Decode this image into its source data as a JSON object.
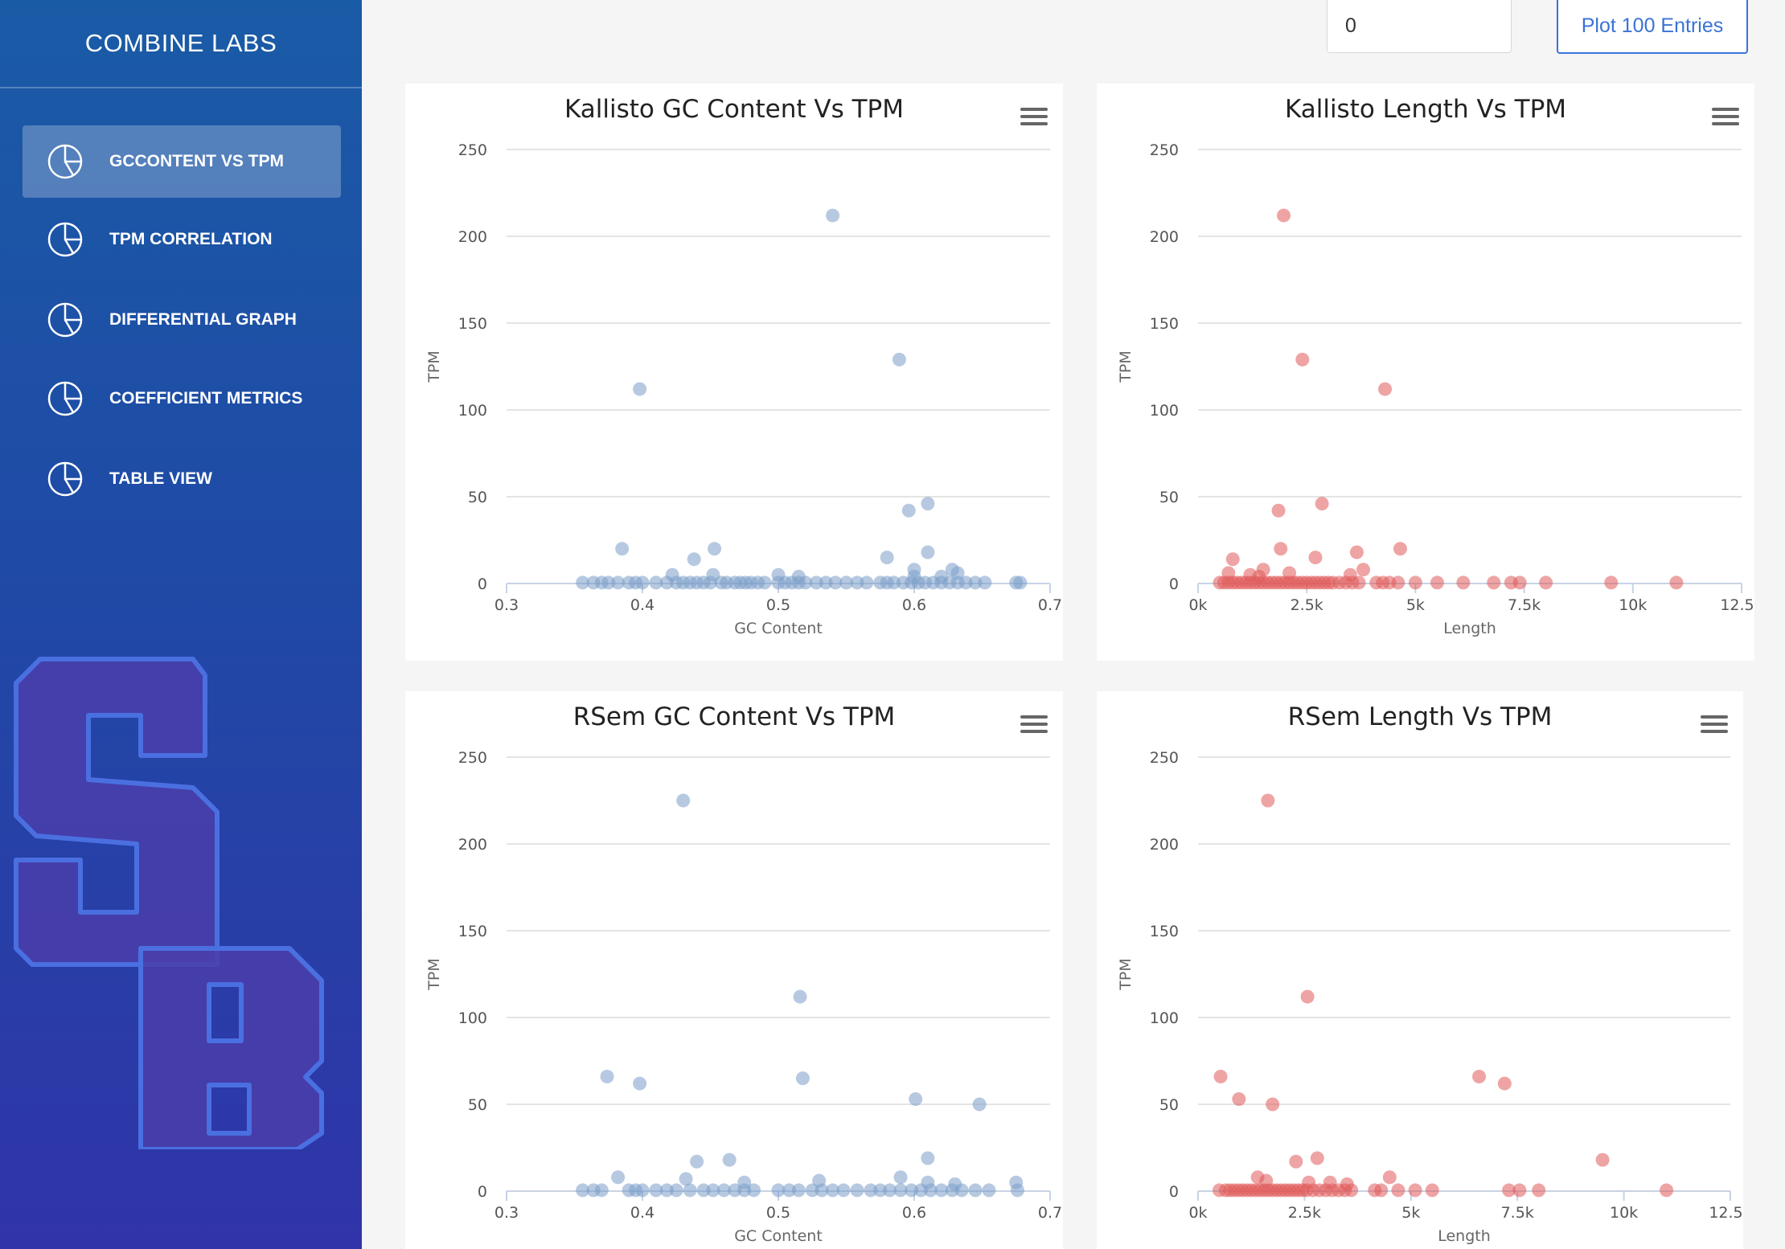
{
  "sidebar": {
    "brand": "COMBINE LABS",
    "items": [
      {
        "label": "GCCONTENT VS TPM",
        "icon": "pie-chart-icon",
        "active": true
      },
      {
        "label": "TPM CORRELATION",
        "icon": "pie-chart-icon",
        "active": false
      },
      {
        "label": "DIFFERENTIAL GRAPH",
        "icon": "pie-chart-icon",
        "active": false
      },
      {
        "label": "COEFFICIENT METRICS",
        "icon": "pie-chart-icon",
        "active": false
      },
      {
        "label": "TABLE VIEW",
        "icon": "pie-chart-icon",
        "active": false
      }
    ],
    "logo_icon": "sb-logo-icon"
  },
  "toolbar": {
    "offset_value": "0",
    "plot_button_label": "Plot 100 Entries"
  },
  "colors": {
    "accent": "#3a73d6",
    "blue_series": "#7a9cc8",
    "red_series": "#e05a5a"
  },
  "chart_data": [
    {
      "type": "scatter",
      "title": "Kallisto GC Content Vs TPM",
      "xlabel": "GC Content",
      "ylabel": "TPM",
      "xlim": [
        0.3,
        0.7
      ],
      "ylim": [
        0,
        250
      ],
      "xticks": [
        "0.3",
        "0.4",
        "0.5",
        "0.6",
        "0.7"
      ],
      "yticks": [
        "0",
        "50",
        "100",
        "150",
        "200",
        "250"
      ],
      "grid": true,
      "color": "#7a9cc8",
      "points": [
        [
          0.54,
          212
        ],
        [
          0.589,
          129
        ],
        [
          0.398,
          112
        ],
        [
          0.61,
          46
        ],
        [
          0.596,
          42
        ],
        [
          0.385,
          20
        ],
        [
          0.453,
          20
        ],
        [
          0.61,
          18
        ],
        [
          0.438,
          14
        ],
        [
          0.58,
          15
        ],
        [
          0.6,
          8
        ],
        [
          0.628,
          8
        ],
        [
          0.632,
          6
        ],
        [
          0.422,
          5
        ],
        [
          0.452,
          5
        ],
        [
          0.5,
          5
        ],
        [
          0.515,
          4
        ],
        [
          0.6,
          4
        ],
        [
          0.62,
          4
        ],
        [
          0.356,
          0.5
        ],
        [
          0.364,
          0.5
        ],
        [
          0.37,
          0.5
        ],
        [
          0.375,
          0.5
        ],
        [
          0.382,
          0.5
        ],
        [
          0.39,
          0.5
        ],
        [
          0.395,
          0.5
        ],
        [
          0.4,
          0.5
        ],
        [
          0.41,
          0.5
        ],
        [
          0.418,
          0.5
        ],
        [
          0.425,
          0.5
        ],
        [
          0.43,
          0.5
        ],
        [
          0.435,
          0.5
        ],
        [
          0.44,
          0.5
        ],
        [
          0.445,
          0.5
        ],
        [
          0.45,
          0.5
        ],
        [
          0.458,
          0.5
        ],
        [
          0.462,
          0.5
        ],
        [
          0.468,
          0.5
        ],
        [
          0.472,
          0.5
        ],
        [
          0.476,
          0.5
        ],
        [
          0.48,
          0.5
        ],
        [
          0.485,
          0.5
        ],
        [
          0.49,
          0.5
        ],
        [
          0.5,
          0.5
        ],
        [
          0.505,
          0.5
        ],
        [
          0.51,
          0.5
        ],
        [
          0.515,
          0.5
        ],
        [
          0.52,
          0.5
        ],
        [
          0.528,
          0.5
        ],
        [
          0.535,
          0.5
        ],
        [
          0.542,
          0.5
        ],
        [
          0.55,
          0.5
        ],
        [
          0.558,
          0.5
        ],
        [
          0.565,
          0.5
        ],
        [
          0.575,
          0.5
        ],
        [
          0.58,
          0.5
        ],
        [
          0.585,
          0.5
        ],
        [
          0.592,
          0.5
        ],
        [
          0.598,
          0.5
        ],
        [
          0.603,
          0.5
        ],
        [
          0.608,
          0.5
        ],
        [
          0.614,
          0.5
        ],
        [
          0.62,
          0.5
        ],
        [
          0.626,
          0.5
        ],
        [
          0.632,
          0.5
        ],
        [
          0.638,
          0.5
        ],
        [
          0.645,
          0.5
        ],
        [
          0.652,
          0.5
        ],
        [
          0.675,
          0.5
        ],
        [
          0.678,
          0.5
        ]
      ]
    },
    {
      "type": "scatter",
      "title": "Kallisto Length Vs TPM",
      "xlabel": "Length",
      "ylabel": "TPM",
      "xlim": [
        0,
        12500
      ],
      "ylim": [
        0,
        250
      ],
      "xticks": [
        "0k",
        "2.5k",
        "5k",
        "7.5k",
        "10k",
        "12.5k"
      ],
      "yticks": [
        "0",
        "50",
        "100",
        "150",
        "200",
        "250"
      ],
      "grid": true,
      "color": "#e05a5a",
      "points": [
        [
          1970,
          212
        ],
        [
          2400,
          129
        ],
        [
          4300,
          112
        ],
        [
          2850,
          46
        ],
        [
          1850,
          42
        ],
        [
          4650,
          20
        ],
        [
          1900,
          20
        ],
        [
          3650,
          18
        ],
        [
          800,
          14
        ],
        [
          2700,
          15
        ],
        [
          3800,
          8
        ],
        [
          1500,
          8
        ],
        [
          2100,
          6
        ],
        [
          700,
          6
        ],
        [
          3500,
          5
        ],
        [
          1200,
          5
        ],
        [
          1400,
          4
        ],
        [
          500,
          0.5
        ],
        [
          600,
          0.5
        ],
        [
          700,
          0.5
        ],
        [
          800,
          0.5
        ],
        [
          900,
          0.5
        ],
        [
          1000,
          0.5
        ],
        [
          1100,
          0.5
        ],
        [
          1200,
          0.5
        ],
        [
          1300,
          0.5
        ],
        [
          1400,
          0.5
        ],
        [
          1500,
          0.5
        ],
        [
          1600,
          0.5
        ],
        [
          1700,
          0.5
        ],
        [
          1800,
          0.5
        ],
        [
          1900,
          0.5
        ],
        [
          2000,
          0.5
        ],
        [
          2100,
          0.5
        ],
        [
          2200,
          0.5
        ],
        [
          2300,
          0.5
        ],
        [
          2400,
          0.5
        ],
        [
          2500,
          0.5
        ],
        [
          2600,
          0.5
        ],
        [
          2700,
          0.5
        ],
        [
          2800,
          0.5
        ],
        [
          2900,
          0.5
        ],
        [
          3000,
          0.5
        ],
        [
          3100,
          0.5
        ],
        [
          3250,
          0.5
        ],
        [
          3400,
          0.5
        ],
        [
          3550,
          0.5
        ],
        [
          3700,
          0.5
        ],
        [
          4100,
          0.5
        ],
        [
          4250,
          0.5
        ],
        [
          4400,
          0.5
        ],
        [
          4600,
          0.5
        ],
        [
          5000,
          0.5
        ],
        [
          5500,
          0.5
        ],
        [
          6100,
          0.5
        ],
        [
          6800,
          0.5
        ],
        [
          7200,
          0.5
        ],
        [
          7400,
          0.5
        ],
        [
          8000,
          0.5
        ],
        [
          9500,
          0.5
        ],
        [
          11000,
          0.5
        ]
      ]
    },
    {
      "type": "scatter",
      "title": "RSem GC Content Vs TPM",
      "xlabel": "GC Content",
      "ylabel": "TPM",
      "xlim": [
        0.3,
        0.7
      ],
      "ylim": [
        0,
        250
      ],
      "xticks": [
        "0.3",
        "0.4",
        "0.5",
        "0.6",
        "0.7"
      ],
      "yticks": [
        "0",
        "50",
        "100",
        "150",
        "200",
        "250"
      ],
      "grid": true,
      "color": "#7a9cc8",
      "points": [
        [
          0.43,
          225
        ],
        [
          0.516,
          112
        ],
        [
          0.374,
          66
        ],
        [
          0.398,
          62
        ],
        [
          0.518,
          65
        ],
        [
          0.601,
          53
        ],
        [
          0.648,
          50
        ],
        [
          0.61,
          19
        ],
        [
          0.464,
          18
        ],
        [
          0.44,
          17
        ],
        [
          0.382,
          8
        ],
        [
          0.432,
          7
        ],
        [
          0.59,
          8
        ],
        [
          0.53,
          6
        ],
        [
          0.61,
          5
        ],
        [
          0.475,
          5
        ],
        [
          0.63,
          4
        ],
        [
          0.675,
          5
        ],
        [
          0.356,
          0.5
        ],
        [
          0.364,
          0.5
        ],
        [
          0.37,
          0.5
        ],
        [
          0.39,
          0.5
        ],
        [
          0.395,
          0.5
        ],
        [
          0.4,
          0.5
        ],
        [
          0.41,
          0.5
        ],
        [
          0.418,
          0.5
        ],
        [
          0.425,
          0.5
        ],
        [
          0.435,
          0.5
        ],
        [
          0.445,
          0.5
        ],
        [
          0.452,
          0.5
        ],
        [
          0.46,
          0.5
        ],
        [
          0.468,
          0.5
        ],
        [
          0.475,
          0.5
        ],
        [
          0.482,
          0.5
        ],
        [
          0.5,
          0.5
        ],
        [
          0.508,
          0.5
        ],
        [
          0.515,
          0.5
        ],
        [
          0.525,
          0.5
        ],
        [
          0.532,
          0.5
        ],
        [
          0.54,
          0.5
        ],
        [
          0.548,
          0.5
        ],
        [
          0.558,
          0.5
        ],
        [
          0.568,
          0.5
        ],
        [
          0.575,
          0.5
        ],
        [
          0.582,
          0.5
        ],
        [
          0.59,
          0.5
        ],
        [
          0.598,
          0.5
        ],
        [
          0.605,
          0.5
        ],
        [
          0.612,
          0.5
        ],
        [
          0.62,
          0.5
        ],
        [
          0.628,
          0.5
        ],
        [
          0.635,
          0.5
        ],
        [
          0.645,
          0.5
        ],
        [
          0.655,
          0.5
        ],
        [
          0.676,
          0.5
        ]
      ]
    },
    {
      "type": "scatter",
      "title": "RSem Length Vs TPM",
      "xlabel": "Length",
      "ylabel": "TPM",
      "xlim": [
        0,
        12500
      ],
      "ylim": [
        0,
        250
      ],
      "xticks": [
        "0k",
        "2.5k",
        "5k",
        "7.5k",
        "10k",
        "12.5k"
      ],
      "yticks": [
        "0",
        "50",
        "100",
        "150",
        "200",
        "250"
      ],
      "grid": true,
      "color": "#e05a5a",
      "points": [
        [
          1640,
          225
        ],
        [
          2570,
          112
        ],
        [
          530,
          66
        ],
        [
          960,
          53
        ],
        [
          1750,
          50
        ],
        [
          6600,
          66
        ],
        [
          7200,
          62
        ],
        [
          9500,
          18
        ],
        [
          2800,
          19
        ],
        [
          2300,
          17
        ],
        [
          4500,
          8
        ],
        [
          1400,
          8
        ],
        [
          1600,
          6
        ],
        [
          2600,
          5
        ],
        [
          3100,
          5
        ],
        [
          3500,
          4
        ],
        [
          500,
          0.5
        ],
        [
          650,
          0.5
        ],
        [
          750,
          0.5
        ],
        [
          850,
          0.5
        ],
        [
          950,
          0.5
        ],
        [
          1050,
          0.5
        ],
        [
          1150,
          0.5
        ],
        [
          1250,
          0.5
        ],
        [
          1350,
          0.5
        ],
        [
          1450,
          0.5
        ],
        [
          1550,
          0.5
        ],
        [
          1650,
          0.5
        ],
        [
          1750,
          0.5
        ],
        [
          1850,
          0.5
        ],
        [
          1950,
          0.5
        ],
        [
          2050,
          0.5
        ],
        [
          2150,
          0.5
        ],
        [
          2250,
          0.5
        ],
        [
          2350,
          0.5
        ],
        [
          2450,
          0.5
        ],
        [
          2550,
          0.5
        ],
        [
          2700,
          0.5
        ],
        [
          2850,
          0.5
        ],
        [
          3000,
          0.5
        ],
        [
          3150,
          0.5
        ],
        [
          3300,
          0.5
        ],
        [
          3450,
          0.5
        ],
        [
          3600,
          0.5
        ],
        [
          4150,
          0.5
        ],
        [
          4300,
          0.5
        ],
        [
          4700,
          0.5
        ],
        [
          5100,
          0.5
        ],
        [
          5500,
          0.5
        ],
        [
          7300,
          0.5
        ],
        [
          7550,
          0.5
        ],
        [
          8000,
          0.5
        ],
        [
          11000,
          0.5
        ]
      ]
    }
  ]
}
